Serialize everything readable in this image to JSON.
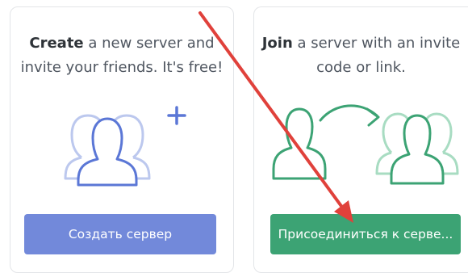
{
  "create_card": {
    "lead_bold": "Create",
    "lead_rest": " a new server and",
    "line2": "invite your friends. It's free!",
    "button_label": "Создать сервер",
    "icon": "users-plus-icon"
  },
  "join_card": {
    "lead_bold": "Join",
    "lead_rest": " a server with an invite",
    "line2": "code or link.",
    "button_label": "Присоединиться к серве...",
    "icon": "user-join-group-icon"
  },
  "annotation": {
    "icon": "red-arrow-icon",
    "color": "#e0413b"
  },
  "colors": {
    "create_accent": "#7289da",
    "join_accent": "#3ca374"
  }
}
